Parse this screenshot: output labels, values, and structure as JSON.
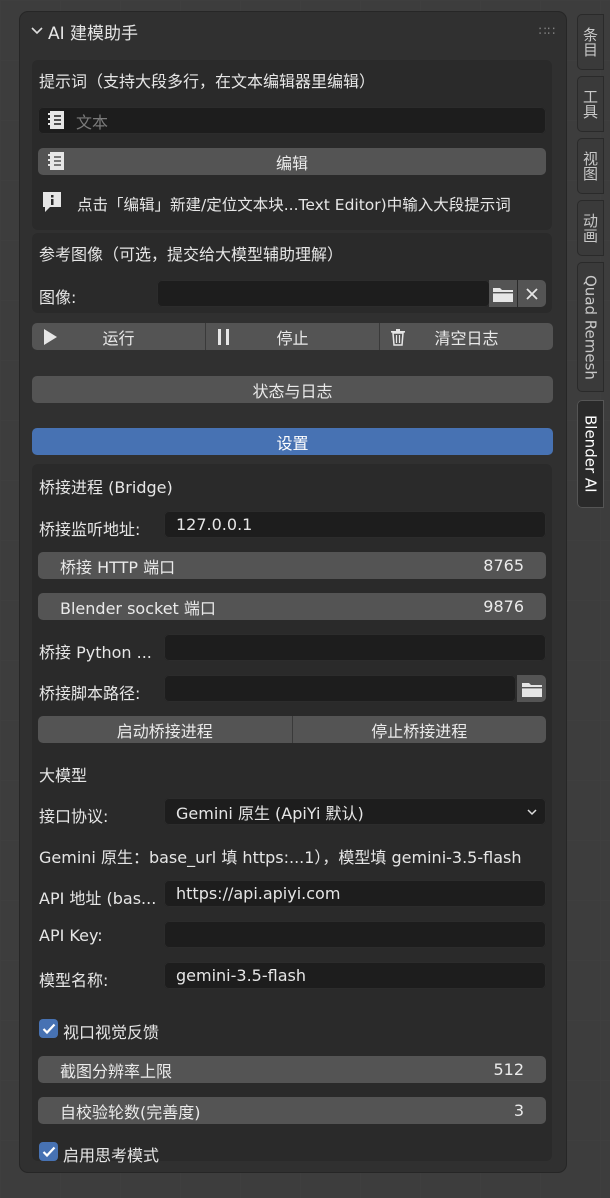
{
  "panel": {
    "title": "AI 建模助手",
    "drag_glyph": "∷∷"
  },
  "prompt_section": {
    "title": "提示词（支持大段多行，在文本编辑器里编辑）",
    "text_placeholder": "文本",
    "edit_button": "编辑",
    "info": "点击「编辑」新建/定位文本块...Text Editor)中输入大段提示词"
  },
  "image_section": {
    "title": "参考图像（可选，提交给大模型辅助理解）",
    "image_label": "图像:",
    "image_value": ""
  },
  "actions": {
    "run": "运行",
    "stop": "停止",
    "clear_log": "清空日志"
  },
  "status_log_button": "状态与日志",
  "settings_button": "设置",
  "bridge": {
    "title": "桥接进程 (Bridge)",
    "listen_label": "桥接监听地址:",
    "listen_value": "127.0.0.1",
    "http_port_label": "桥接 HTTP 端口",
    "http_port_value": "8765",
    "socket_port_label": "Blender socket 端口",
    "socket_port_value": "9876",
    "python_label": "桥接 Python ...",
    "python_value": "",
    "script_label": "桥接脚本路径:",
    "script_value": "",
    "start_button": "启动桥接进程",
    "stop_button": "停止桥接进程"
  },
  "llm": {
    "title": "大模型",
    "protocol_label": "接口协议:",
    "protocol_value": "Gemini 原生 (ApiYi 默认)",
    "hint": "Gemini 原生：base_url 填 https:...1），模型填 gemini-3.5-flash",
    "api_url_label": "API 地址 (bas...",
    "api_url_value": "https://api.apiyi.com",
    "api_key_label": "API Key:",
    "api_key_value": "",
    "model_label": "模型名称:",
    "model_value": "gemini-3.5-flash"
  },
  "options": {
    "viewport_feedback_label": "视口视觉反馈",
    "viewport_feedback_checked": true,
    "screenshot_res_label": "截图分辨率上限",
    "screenshot_res_value": "512",
    "self_check_label": "自校验轮数(完善度)",
    "self_check_value": "3",
    "thinking_label": "启用思考模式",
    "thinking_checked": true
  },
  "side_tabs": [
    {
      "label": "条目",
      "active": false
    },
    {
      "label": "工具",
      "active": false
    },
    {
      "label": "视图",
      "active": false
    },
    {
      "label": "动画",
      "active": false
    },
    {
      "label": "Quad Remesh",
      "active": false
    },
    {
      "label": "Blender AI",
      "active": true
    }
  ],
  "colors": {
    "accent": "#4772b3",
    "panel": "#303030",
    "field": "#1d1d1d",
    "button": "#545454"
  }
}
